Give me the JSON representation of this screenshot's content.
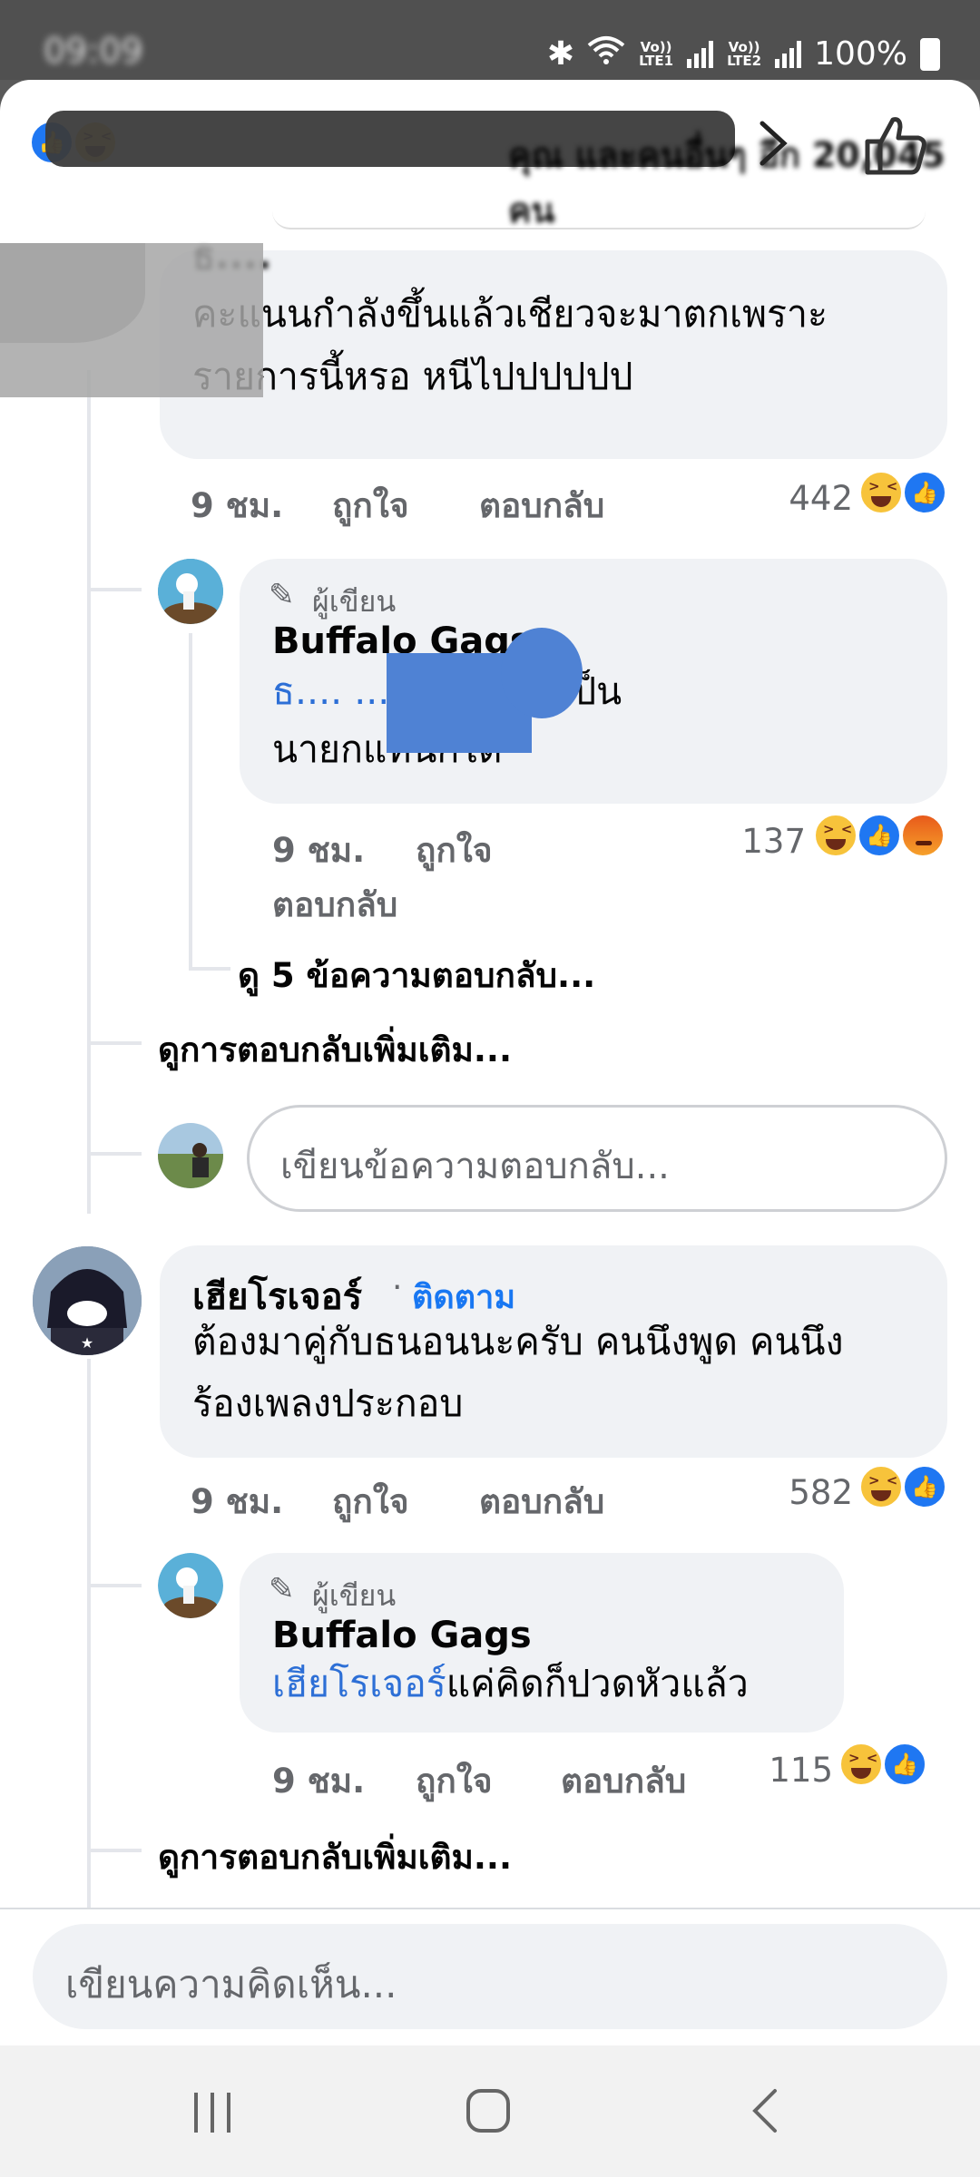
{
  "status_bar": {
    "time": "09:09",
    "battery": "100%",
    "net1": "Vo)) LTE1",
    "net2": "Vo)) LTE2"
  },
  "header": {
    "reaction_count": "คุณ และคนอื่นๆ อีก 20,045 คน"
  },
  "comments": [
    {
      "author": "ธ....",
      "text_lines": [
        "คะแนนกำลังขึ้นแล้วเชียวจะมาตกเพราะ",
        "รายการนี้หรอ หนีไปปปปปป"
      ],
      "time": "9 ชม.",
      "like": "ถูกใจ",
      "reply": "ตอบกลับ",
      "reaction_count": "442",
      "replies": [
        {
          "author_tag": "ผู้เขียน",
          "author": "Buffalo Gags",
          "mention": "ธ.... ....g",
          "text_after_mention": " งั้นเดี๋ยวเป็น",
          "text_line2": "นายกแทนก็ได้",
          "time": "9 ชม.",
          "like": "ถูกใจ",
          "reply": "ตอบกลับ",
          "reaction_count": "137"
        }
      ],
      "view_more_replies": "ดู 5 ข้อความตอบกลับ...",
      "more_replies": "ดูการตอบกลับเพิ่มเติม...",
      "reply_placeholder": "เขียนข้อความตอบกลับ..."
    },
    {
      "author": "เฮียโรเจอร์",
      "follow_sep": "·",
      "follow": "ติดตาม",
      "text_lines": [
        "ต้องมาคู่กับธนอนนะครับ คนนึงพูด คนนึง",
        "ร้องเพลงประกอบ"
      ],
      "time": "9 ชม.",
      "like": "ถูกใจ",
      "reply": "ตอบกลับ",
      "reaction_count": "582",
      "replies": [
        {
          "author_tag": "ผู้เขียน",
          "author": "Buffalo Gags",
          "mention": "เฮียโรเจอร์",
          "text_after_mention": "แค่คิดก็ปวดหัวแล้ว",
          "time": "9 ชม.",
          "like": "ถูกใจ",
          "reply": "ตอบกลับ",
          "reaction_count": "115"
        }
      ],
      "more_replies": "ดูการตอบกลับเพิ่มเติม..."
    }
  ],
  "composer": {
    "placeholder": "เขียนความคิดเห็น..."
  },
  "nav": {
    "recent": "|||",
    "home": "○",
    "back": "<"
  },
  "colors": {
    "accent": "#1877f2",
    "bubble": "#f0f2f5",
    "muted": "#65676b"
  }
}
